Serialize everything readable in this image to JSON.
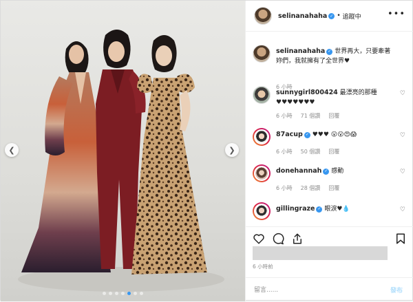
{
  "post": {
    "author": "selinanahaha",
    "follow_separator": "•",
    "follow_status": "追蹤中",
    "more_icon": "more-horizontal-icon",
    "caption": {
      "username": "selinanahaha",
      "text": "世界再大，只要牽著妳們，我就擁有了全世界♥",
      "time": "6 小時"
    },
    "carousel": {
      "image_count": 7,
      "active_index": 4
    }
  },
  "comments": [
    {
      "username": "sunnygirl800424",
      "verified": false,
      "text": "最漂亮的那種♥♥♥♥♥♥♥",
      "time": "6 小時",
      "likes": "71 個讚",
      "reply": "回覆"
    },
    {
      "username": "87acup",
      "verified": true,
      "text": "♥♥♥ 😮😮😍😱",
      "time": "6 小時",
      "likes": "50 個讚",
      "reply": "回覆"
    },
    {
      "username": "donehannah",
      "verified": true,
      "text": "感動",
      "time": "6 小時",
      "likes": "28 個讚",
      "reply": "回覆"
    },
    {
      "username": "gillingraze",
      "verified": true,
      "text": "眼淚♥💧",
      "time": "",
      "likes": "",
      "reply": ""
    }
  ],
  "footer": {
    "time_ago": "6 小時前",
    "comment_placeholder": "留言......",
    "post_label": "發布"
  },
  "colors": {
    "accent": "#3897f0",
    "post_disabled": "#b2dffc",
    "muted": "#8e8e8e"
  }
}
